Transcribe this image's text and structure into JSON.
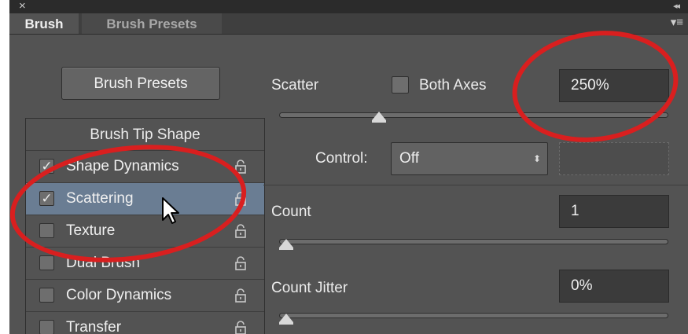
{
  "window": {
    "close_glyph": "×",
    "collapse_glyph": "◂◂",
    "menu_glyph": "▾≡"
  },
  "tabs": [
    {
      "label": "Brush",
      "active": true
    },
    {
      "label": "Brush Presets",
      "active": false
    }
  ],
  "left": {
    "presets_button": "Brush Presets",
    "tip_header": "Brush Tip Shape",
    "items": [
      {
        "label": "Shape Dynamics",
        "checked": true,
        "selected": false
      },
      {
        "label": "Scattering",
        "checked": true,
        "selected": true
      },
      {
        "label": "Texture",
        "checked": false,
        "selected": false
      },
      {
        "label": "Dual Brush",
        "checked": false,
        "selected": false
      },
      {
        "label": "Color Dynamics",
        "checked": false,
        "selected": false
      },
      {
        "label": "Transfer",
        "checked": false,
        "selected": false
      }
    ]
  },
  "scatter": {
    "label": "Scatter",
    "both_axes_label": "Both Axes",
    "both_axes_checked": false,
    "value": "250%",
    "slider_fraction": 0.25
  },
  "control": {
    "label": "Control:",
    "value": "Off"
  },
  "count": {
    "label": "Count",
    "value": "1",
    "slider_fraction": 0
  },
  "count_jitter": {
    "label": "Count Jitter",
    "value": "0%",
    "slider_fraction": 0
  },
  "colors": {
    "panel_bg": "#535353",
    "selection": "#6a7d93",
    "annotation_red": "#d91f1f"
  }
}
